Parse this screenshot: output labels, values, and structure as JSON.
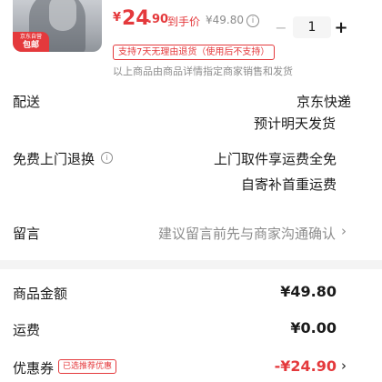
{
  "product": {
    "badge_top": "京东自营",
    "badge_main": "包邮",
    "currency": "¥",
    "price_int": "24",
    "price_dec": ".90",
    "final_label": "到手价",
    "original_price": "¥49.80",
    "quantity": "1",
    "return_tag": "支持7天无理由退货（使用后不支持）",
    "seller_note": "以上商品由商品详情指定商家销售和发货"
  },
  "delivery": {
    "label": "配送",
    "carrier": "京东快递",
    "eta": "预计明天发货"
  },
  "return_service": {
    "label": "免费上门退换",
    "line1": "上门取件享运费全免",
    "line2": "自寄补首重运费"
  },
  "message": {
    "label": "留言",
    "placeholder": "建议留言前先与商家沟通确认"
  },
  "summary": {
    "goods_amount_label": "商品金额",
    "goods_amount": "¥49.80",
    "shipping_label": "运费",
    "shipping": "¥0.00",
    "coupon_label": "优惠券",
    "coupon_tag": "已选推荐优惠",
    "coupon_value": "-¥24.90"
  },
  "colors": {
    "accent": "#e4393c",
    "muted": "#8c8c8c",
    "divider": "#f4f4f4"
  },
  "icons": [
    "info-icon",
    "chevron-right-icon",
    "minus-icon",
    "plus-icon"
  ]
}
